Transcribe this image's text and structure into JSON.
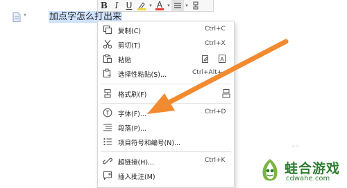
{
  "document": {
    "selected_text": "加点字怎么打出来"
  },
  "mini_toolbar": {
    "bold": "B",
    "italic": "I",
    "underline": "U",
    "font_color_letter": "A",
    "colors": {
      "highlight": "#f3d53a",
      "font_color": "#e53935"
    }
  },
  "context_menu": {
    "items": [
      {
        "label": "复制(C)",
        "shortcut": "Ctrl+C",
        "icon": "copy-icon"
      },
      {
        "label": "剪切(T)",
        "shortcut": "Ctrl+X",
        "icon": "scissors-icon"
      },
      {
        "label": "粘贴",
        "shortcut": "",
        "icon": "paste-icon"
      },
      {
        "label": "选择性粘贴(S)...",
        "shortcut": "Ctrl+Alt+",
        "icon": "paste-special-icon"
      },
      {
        "label": "格式刷(F)",
        "shortcut": "",
        "icon": "format-painter-icon"
      },
      {
        "label": "字体(F)...",
        "shortcut": "Ctrl+D",
        "icon": "font-icon"
      },
      {
        "label": "段落(P)...",
        "shortcut": "",
        "icon": "paragraph-icon"
      },
      {
        "label": "项目符号和编号(N)...",
        "shortcut": "",
        "icon": "bullets-icon"
      },
      {
        "label": "超链接(H)...",
        "shortcut": "Ctrl+K",
        "icon": "hyperlink-icon"
      },
      {
        "label": "插入批注(M)",
        "shortcut": "",
        "icon": "comment-icon"
      }
    ]
  },
  "annotation": {
    "arrow_color": "#f28a30",
    "points_to": "字体(F)..."
  },
  "watermark": {
    "title": "蛙合游戏",
    "url": "cdwahe.com",
    "brand_color": "#2e7d32"
  }
}
